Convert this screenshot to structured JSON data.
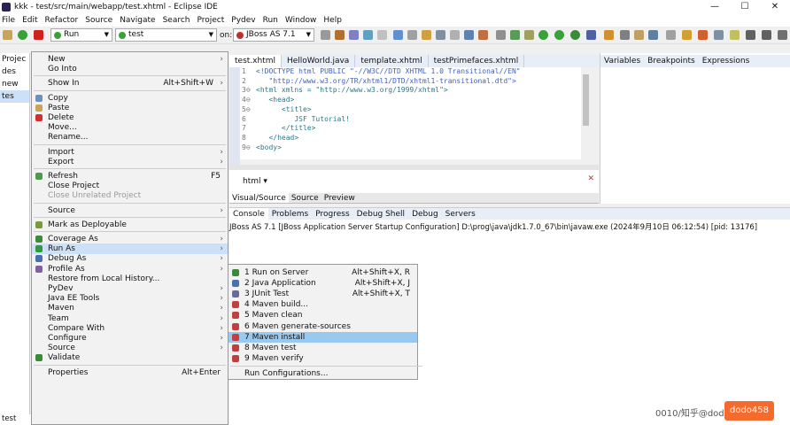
{
  "window": {
    "title": "kkk - test/src/main/webapp/test.xhtml - Eclipse IDE",
    "controls": [
      "—",
      "☐",
      "✕"
    ]
  },
  "menubar": [
    "File",
    "Edit",
    "Refactor",
    "Source",
    "Navigate",
    "Search",
    "Project",
    "Pydev",
    "Run",
    "Window",
    "Help"
  ],
  "toolbar": {
    "run_mode": "Run",
    "launch_config": "test",
    "on_label": "on:",
    "server": "JBoss AS 7.1"
  },
  "explorer": {
    "items": [
      "Projec",
      "des",
      "new",
      "tes"
    ],
    "bottom_item": "test"
  },
  "editor": {
    "tabs": [
      "test.xhtml",
      "HelloWorld.java",
      "template.xhtml",
      "testPrimefaces.xhtml"
    ],
    "active_tab": 0,
    "lines": [
      {
        "n": "1",
        "text": "<!DOCTYPE html PUBLIC \"-//W3C//DTD XHTML 1.0 Transitional//EN\""
      },
      {
        "n": "2",
        "text": "   \"http://www.w3.org/TR/xhtml1/DTD/xhtml1-transitional.dtd\">"
      },
      {
        "n": "3⊖",
        "text": "<html xmlns = \"http://www.w3.org/1999/xhtml\">"
      },
      {
        "n": "4⊖",
        "text": "   <head>"
      },
      {
        "n": "5⊖",
        "text": "      <title>"
      },
      {
        "n": "6",
        "text": "         JSF Tutorial!"
      },
      {
        "n": "7",
        "text": "      </title>"
      },
      {
        "n": "8",
        "text": "   </head>"
      },
      {
        "n": "9⊖",
        "text": "<body>"
      }
    ],
    "html_label": "html",
    "visual_tabs": [
      "Visual/Source",
      "Source",
      "Preview"
    ]
  },
  "right_panel": {
    "tabs": [
      "Variables",
      "Breakpoints",
      "Expressions"
    ]
  },
  "console": {
    "tabs": [
      "Console",
      "Problems",
      "Progress",
      "Debug Shell",
      "Debug",
      "Servers"
    ],
    "line": "JBoss AS 7.1 [JBoss Application Server Startup Configuration] D:\\prog\\java\\jdk1.7.0_67\\bin\\javaw.exe  (2024年9月10日 06:12:54) [pid: 13176]"
  },
  "context_menu": {
    "items": [
      {
        "label": "New",
        "sub": true
      },
      {
        "label": "Go Into"
      },
      {
        "sep": true
      },
      {
        "label": "Show In",
        "shortcut": "Alt+Shift+W",
        "sub": true
      },
      {
        "sep": true
      },
      {
        "label": "Copy",
        "icon": "copy-icon",
        "color": "#6a8fc0"
      },
      {
        "label": "Paste",
        "icon": "paste-icon",
        "color": "#c9a35a"
      },
      {
        "label": "Delete",
        "icon": "delete-icon",
        "color": "#d03030"
      },
      {
        "label": "Move..."
      },
      {
        "label": "Rename..."
      },
      {
        "sep": true
      },
      {
        "label": "Import",
        "sub": true
      },
      {
        "label": "Export",
        "sub": true
      },
      {
        "sep": true
      },
      {
        "label": "Refresh",
        "shortcut": "F5",
        "icon": "refresh-icon",
        "color": "#4f9a4f"
      },
      {
        "label": "Close Project"
      },
      {
        "label": "Close Unrelated Project",
        "disabled": true
      },
      {
        "sep": true
      },
      {
        "label": "Source",
        "sub": true
      },
      {
        "sep": true
      },
      {
        "label": "Mark as Deployable",
        "icon": "deploy-icon",
        "color": "#7a9a3a"
      },
      {
        "sep": true
      },
      {
        "label": "Coverage As",
        "icon": "coverage-icon",
        "color": "#3c8a3c",
        "sub": true
      },
      {
        "label": "Run As",
        "icon": "run-icon",
        "color": "#2f9a3a",
        "sub": true,
        "highlighted": true
      },
      {
        "label": "Debug As",
        "icon": "debug-icon",
        "color": "#4a6fb0",
        "sub": true
      },
      {
        "label": "Profile As",
        "icon": "profile-icon",
        "color": "#8060a0",
        "sub": true
      },
      {
        "label": "Restore from Local History..."
      },
      {
        "label": "PyDev",
        "sub": true
      },
      {
        "label": "Java EE Tools",
        "sub": true
      },
      {
        "label": "Maven",
        "sub": true
      },
      {
        "label": "Team",
        "sub": true
      },
      {
        "label": "Compare With",
        "sub": true
      },
      {
        "label": "Configure",
        "sub": true
      },
      {
        "label": "Source",
        "sub": true
      },
      {
        "label": "Validate",
        "icon": "validate-icon",
        "color": "#3a8a3a"
      },
      {
        "sep": true
      },
      {
        "label": "Properties",
        "shortcut": "Alt+Enter"
      }
    ]
  },
  "run_as_submenu": {
    "items": [
      {
        "label": "1 Run on Server",
        "shortcut": "Alt+Shift+X, R",
        "icon": "server-icon",
        "color": "#3a8a3a"
      },
      {
        "label": "2 Java Application",
        "shortcut": "Alt+Shift+X, J",
        "icon": "java-app-icon",
        "color": "#4a70b0"
      },
      {
        "label": "3 JUnit Test",
        "shortcut": "Alt+Shift+X, T",
        "icon": "junit-icon",
        "color": "#6a6a9a"
      },
      {
        "label": "4 Maven build...",
        "icon": "maven-icon",
        "color": "#c04040"
      },
      {
        "label": "5 Maven clean",
        "icon": "maven-icon",
        "color": "#c04040"
      },
      {
        "label": "6 Maven generate-sources",
        "icon": "maven-icon",
        "color": "#c04040"
      },
      {
        "label": "7 Maven install",
        "icon": "maven-icon",
        "color": "#c04040",
        "selected": true
      },
      {
        "label": "8 Maven test",
        "icon": "maven-icon",
        "color": "#c04040"
      },
      {
        "label": "9 Maven verify",
        "icon": "maven-icon",
        "color": "#c04040"
      },
      {
        "sep": true
      },
      {
        "label": "Run Configurations..."
      }
    ]
  },
  "watermark": "0010/知乎@dodo458",
  "badge": "dodo458"
}
